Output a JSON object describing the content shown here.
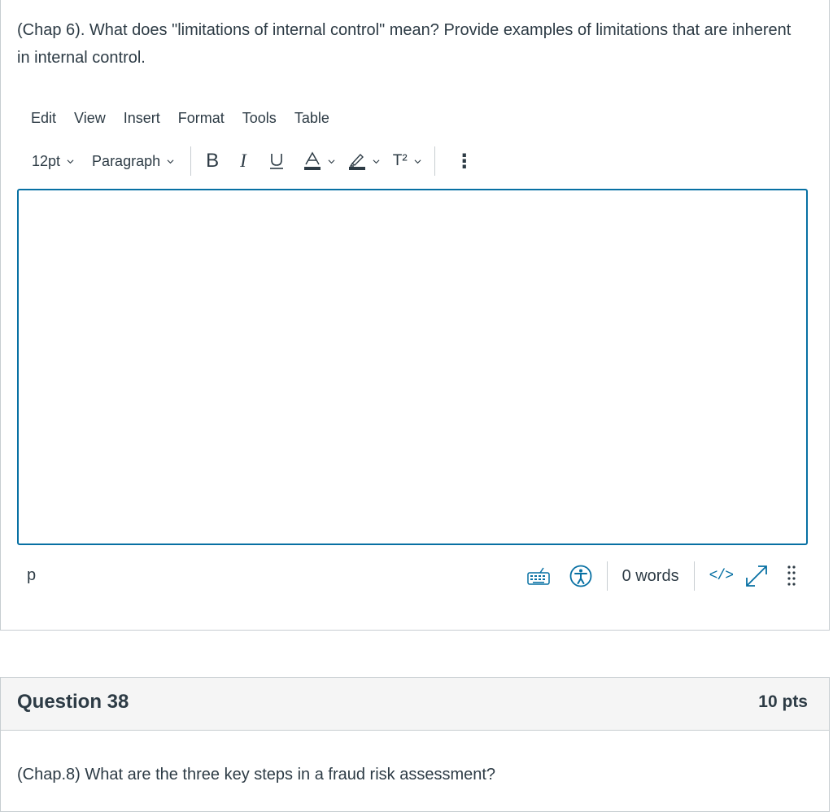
{
  "question_37": {
    "text": "(Chap 6). What does \"limitations of internal control\" mean? Provide examples of limitations that are inherent in internal control."
  },
  "editor": {
    "menu": [
      "Edit",
      "View",
      "Insert",
      "Format",
      "Tools",
      "Table"
    ],
    "font_size": "12pt",
    "block_format": "Paragraph",
    "bold_label": "B",
    "italic_label": "I",
    "underline_label": "U",
    "text_color_label": "A",
    "superscript_label": "T²",
    "more_label": "⋮",
    "content": "",
    "path": "p",
    "word_count": "0 words",
    "html_editor_label": "</>",
    "accent_color": "#0770a3"
  },
  "question_38": {
    "title": "Question 38",
    "points": "10 pts",
    "text": "(Chap.8) What are the three key steps in a fraud risk assessment?"
  }
}
